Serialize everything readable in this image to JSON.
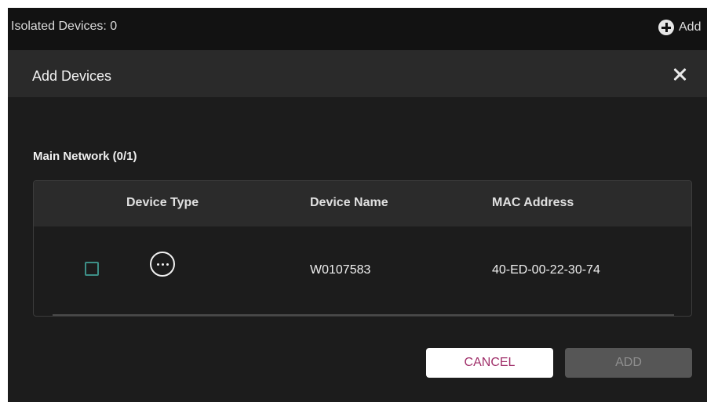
{
  "topbar": {
    "isolated_label": "Isolated Devices: 0",
    "add_label": "Add",
    "add_icon": "plus-circle-icon"
  },
  "modal": {
    "title": "Add Devices",
    "close_icon": "close-icon",
    "section_title": "Main Network (0/1)",
    "table": {
      "columns": [
        "Device Type",
        "Device Name",
        "MAC Address"
      ],
      "rows": [
        {
          "checked": false,
          "type_icon": "more-horizontal-icon",
          "name": "W0107583",
          "mac": "40-ED-00-22-30-74"
        }
      ]
    },
    "buttons": {
      "cancel": "CANCEL",
      "add": "ADD"
    }
  },
  "colors": {
    "topbar_bg": "#121212",
    "modal_bg": "#1c1c1c",
    "header_bg": "#2a2a2a",
    "checkbox_border": "#3d8f87",
    "cancel_text": "#a0306a",
    "add_disabled_bg": "#565656"
  }
}
